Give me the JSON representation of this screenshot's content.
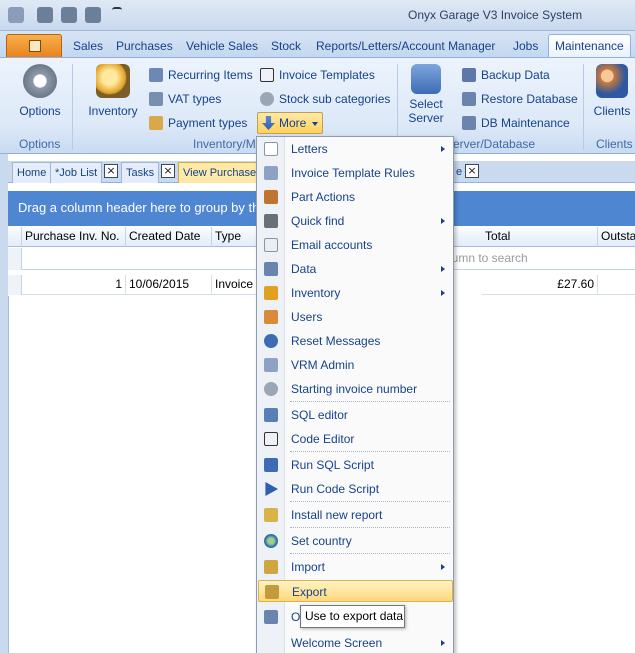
{
  "window": {
    "title": "Onyx Garage V3 Invoice System"
  },
  "tabs": [
    {
      "label": "Sales"
    },
    {
      "label": "Purchases"
    },
    {
      "label": "Vehicle Sales"
    },
    {
      "label": "Stock"
    },
    {
      "label": "Reports/Letters/Account Manager"
    },
    {
      "label": "Jobs"
    },
    {
      "label": "Maintenance"
    }
  ],
  "ribbon": {
    "options": {
      "button": "Options",
      "group": "Options"
    },
    "inventory": {
      "button": "Inventory",
      "group": "Inventory/M",
      "recurring": "Recurring Items",
      "vat": "VAT types",
      "payment": "Payment types",
      "invoice_templates": "Invoice Templates",
      "stock_sub": "Stock sub categories",
      "more": "More"
    },
    "server": {
      "select_line1": "Select",
      "select_line2": "Server",
      "backup": "Backup Data",
      "restore": "Restore Database",
      "db_maint": "DB Maintenance",
      "group": "erver/Database"
    },
    "clients": {
      "button": "Clients",
      "group": "Clients"
    }
  },
  "doc_tabs": [
    {
      "label": "Home"
    },
    {
      "label": "*Job List"
    },
    {
      "label": "Tasks"
    },
    {
      "label": "View Purchase"
    },
    {
      "label": "e"
    }
  ],
  "grid": {
    "group_hint": "Drag a column header here to group by th",
    "columns": [
      "Purchase Inv. No.",
      "Created Date",
      "Type",
      "Total",
      "Outsta"
    ],
    "filter_hint": "lumn to search",
    "rows": [
      {
        "inv_no": "1",
        "date": "10/06/2015",
        "type": "Invoice",
        "total": "£27.60"
      }
    ]
  },
  "menu": {
    "items": [
      {
        "label": "Letters",
        "sub": true
      },
      {
        "label": "Invoice Template Rules",
        "sub": false
      },
      {
        "label": "Part Actions",
        "sub": false
      },
      {
        "label": "Quick find",
        "sub": true
      },
      {
        "label": "Email accounts",
        "sub": false
      },
      {
        "label": "Data",
        "sub": true
      },
      {
        "label": "Inventory",
        "sub": true
      },
      {
        "label": "Users",
        "sub": false
      },
      {
        "label": "Reset Messages",
        "sub": false
      },
      {
        "label": "VRM Admin",
        "sub": false
      },
      {
        "label": "Starting invoice number",
        "sub": false
      },
      {
        "label": "SQL editor",
        "sub": false
      },
      {
        "label": "Code Editor",
        "sub": false
      },
      {
        "label": "Run SQL Script",
        "sub": false
      },
      {
        "label": "Run Code Script",
        "sub": false
      },
      {
        "label": "Install new report",
        "sub": false
      },
      {
        "label": "Set country",
        "sub": false
      },
      {
        "label": "Import",
        "sub": true
      },
      {
        "label": "Export",
        "sub": false
      },
      {
        "label": "O",
        "sub": false
      },
      {
        "label": "Welcome Screen",
        "sub": true
      }
    ]
  },
  "tooltip": "Use to export data",
  "colors": {
    "accent": "#4f86d2",
    "highlight": "#ffd97a",
    "app_button": "#e8801c"
  }
}
